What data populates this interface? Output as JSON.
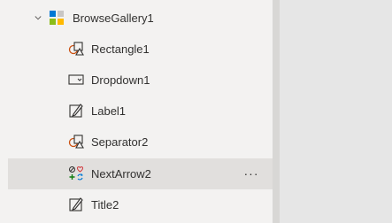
{
  "tree": {
    "gallery": {
      "label": "BrowseGallery1",
      "expand_icon": "chevron-down-icon",
      "icon": "gallery-icon"
    },
    "children": [
      {
        "label": "Rectangle1",
        "icon": "shape-icon"
      },
      {
        "label": "Dropdown1",
        "icon": "dropdown-icon"
      },
      {
        "label": "Label1",
        "icon": "label-edit-icon"
      },
      {
        "label": "Separator2",
        "icon": "shape-icon"
      },
      {
        "label": "NextArrow2",
        "icon": "icon-control-icon",
        "selected": true,
        "more_label": "···"
      },
      {
        "label": "Title2",
        "icon": "label-edit-icon"
      }
    ]
  },
  "colors": {
    "panel_bg": "#f3f2f1",
    "selected_bg": "#e1dfdd",
    "text": "#323130",
    "canvas_bg": "#e6e6e6",
    "icon_orange": "#ca5010",
    "icon_green": "#107c10",
    "icon_red": "#d13438",
    "icon_blue": "#0078d4"
  }
}
